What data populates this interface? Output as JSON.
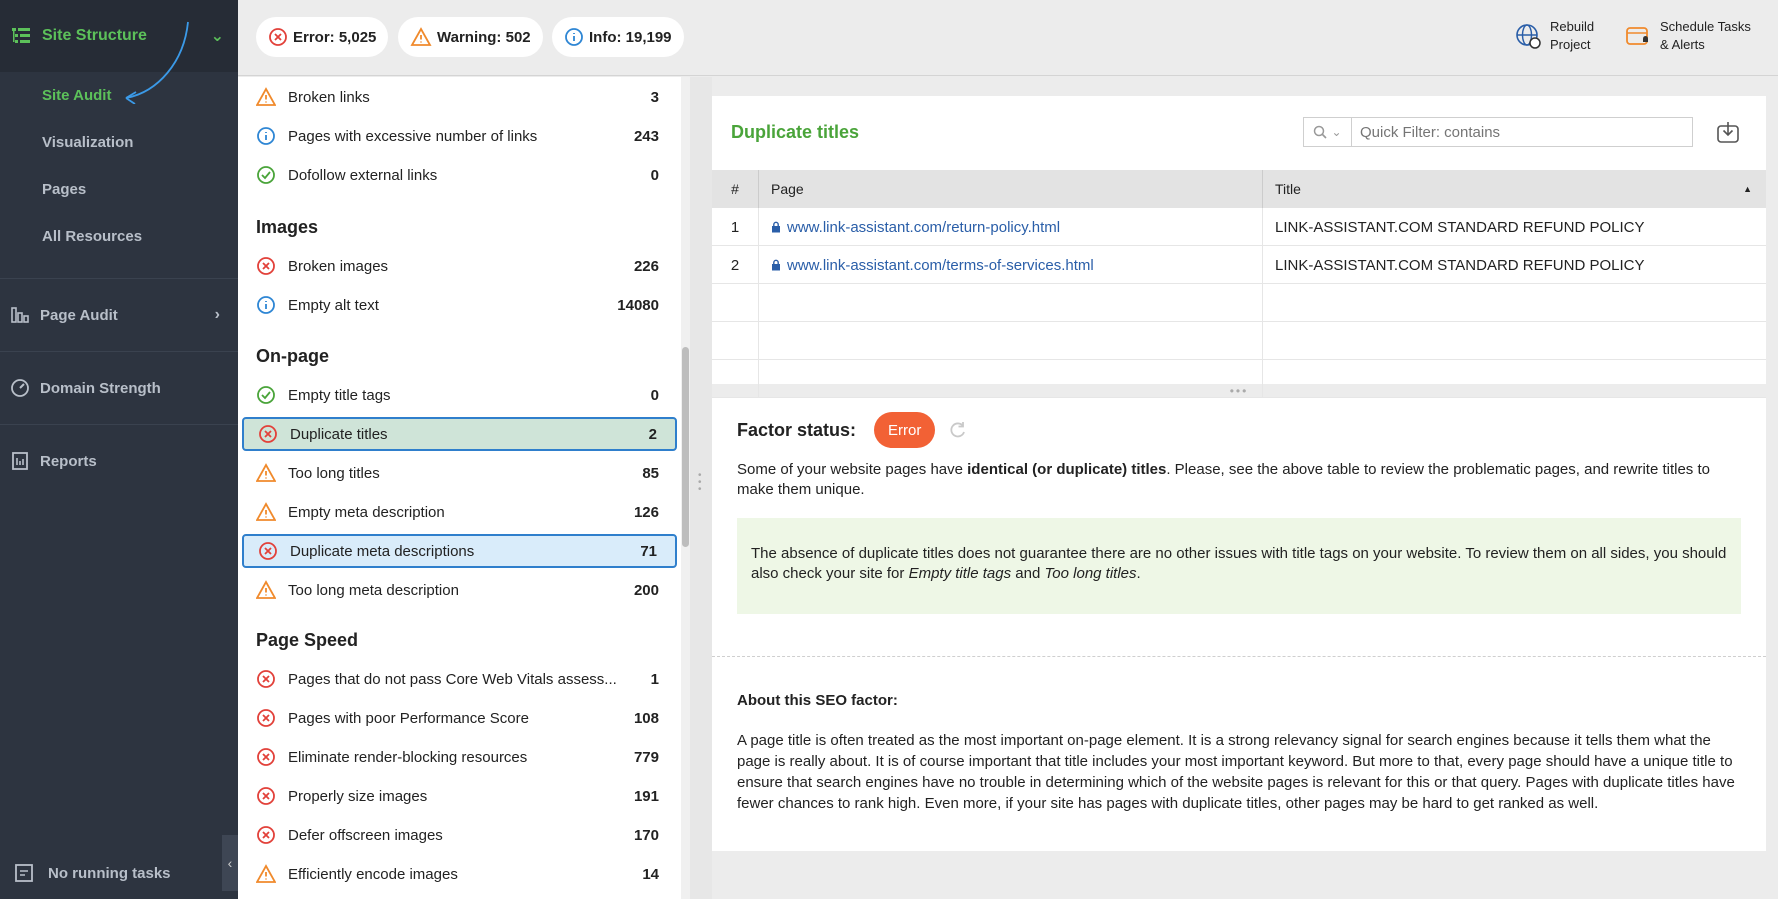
{
  "sidebar": {
    "section_title": "Site Structure",
    "sub_items": [
      {
        "label": "Site Audit",
        "active": true
      },
      {
        "label": "Visualization",
        "active": false
      },
      {
        "label": "Pages",
        "active": false
      },
      {
        "label": "All Resources",
        "active": false
      }
    ],
    "groups": [
      {
        "label": "Page Audit",
        "icon": "page-audit-icon"
      },
      {
        "label": "Domain Strength",
        "icon": "gauge-icon"
      },
      {
        "label": "Reports",
        "icon": "reports-icon"
      }
    ],
    "footer": "No running tasks"
  },
  "topbar": {
    "error": "Error: 5,025",
    "warning": "Warning: 502",
    "info": "Info: 19,199",
    "rebuild": [
      "Rebuild",
      "Project"
    ],
    "schedule": [
      "Schedule Tasks",
      "& Alerts"
    ]
  },
  "list": {
    "top_rows": [
      {
        "icon": "warning",
        "label": "Broken links",
        "count": "3"
      },
      {
        "icon": "info",
        "label": "Pages with excessive number of links",
        "count": "243"
      },
      {
        "icon": "ok",
        "label": "Dofollow external links",
        "count": "0"
      }
    ],
    "categories": {
      "images": "Images",
      "onpage": "On-page",
      "pagespeed": "Page Speed"
    },
    "images_rows": [
      {
        "icon": "error",
        "label": "Broken images",
        "count": "226"
      },
      {
        "icon": "info",
        "label": "Empty alt text",
        "count": "14080"
      }
    ],
    "onpage_rows": [
      {
        "icon": "ok",
        "label": "Empty title tags",
        "count": "0"
      },
      {
        "icon": "error",
        "label": "Duplicate titles",
        "count": "2",
        "selected": "green"
      },
      {
        "icon": "warning",
        "label": "Too long titles",
        "count": "85"
      },
      {
        "icon": "warning",
        "label": "Empty meta description",
        "count": "126"
      },
      {
        "icon": "error",
        "label": "Duplicate meta descriptions",
        "count": "71",
        "selected": "blue"
      },
      {
        "icon": "warning",
        "label": "Too long meta description",
        "count": "200"
      }
    ],
    "pagespeed_rows": [
      {
        "icon": "error",
        "label": "Pages that do not pass Core Web Vitals assess...",
        "count": "1"
      },
      {
        "icon": "error",
        "label": "Pages with poor Performance Score",
        "count": "108"
      },
      {
        "icon": "error",
        "label": "Eliminate render-blocking resources",
        "count": "779"
      },
      {
        "icon": "error",
        "label": "Properly size images",
        "count": "191"
      },
      {
        "icon": "error",
        "label": "Defer offscreen images",
        "count": "170"
      },
      {
        "icon": "warning",
        "label": "Efficiently encode images",
        "count": "14"
      }
    ]
  },
  "table": {
    "title": "Duplicate titles",
    "filter_placeholder": "Quick Filter: contains",
    "columns": [
      "#",
      "Page",
      "Title"
    ],
    "rows": [
      {
        "num": "1",
        "page": "www.link-assistant.com/return-policy.html",
        "title": "LINK-ASSISTANT.COM STANDARD REFUND POLICY"
      },
      {
        "num": "2",
        "page": "www.link-assistant.com/terms-of-services.html",
        "title": "LINK-ASSISTANT.COM STANDARD REFUND POLICY"
      }
    ]
  },
  "factor": {
    "label": "Factor status:",
    "badge": "Error",
    "desc_pre": "Some of your website pages have ",
    "desc_bold": "identical (or duplicate) titles",
    "desc_post": ". Please, see the above table to review the problematic pages, and rewrite titles to make them unique.",
    "tip_pre": "The absence of duplicate titles does not guarantee there are no other issues with title tags on your website. To review them on all sides, you should also check your site for ",
    "tip_em1": "Empty title tags",
    "tip_mid": " and ",
    "tip_em2": "Too long titles",
    "tip_post": ".",
    "about_heading": "About this SEO factor:",
    "about_text": "A page title is often treated as the most important on-page element. It is a strong relevancy signal for search engines because it tells them what the page is really about. It is of course important that title includes your most important keyword. But more to that, every page should have a unique title to ensure that search engines have no trouble in determining which of the website pages is relevant for this or that query. Pages with duplicate titles have fewer chances to rank high. Even more, if your site has pages with duplicate titles, other pages may be hard to get ranked as well."
  },
  "colors": {
    "accent_green": "#5cc15a",
    "error": "#e2413a",
    "warning": "#f08a2c",
    "info": "#2e86d4"
  }
}
